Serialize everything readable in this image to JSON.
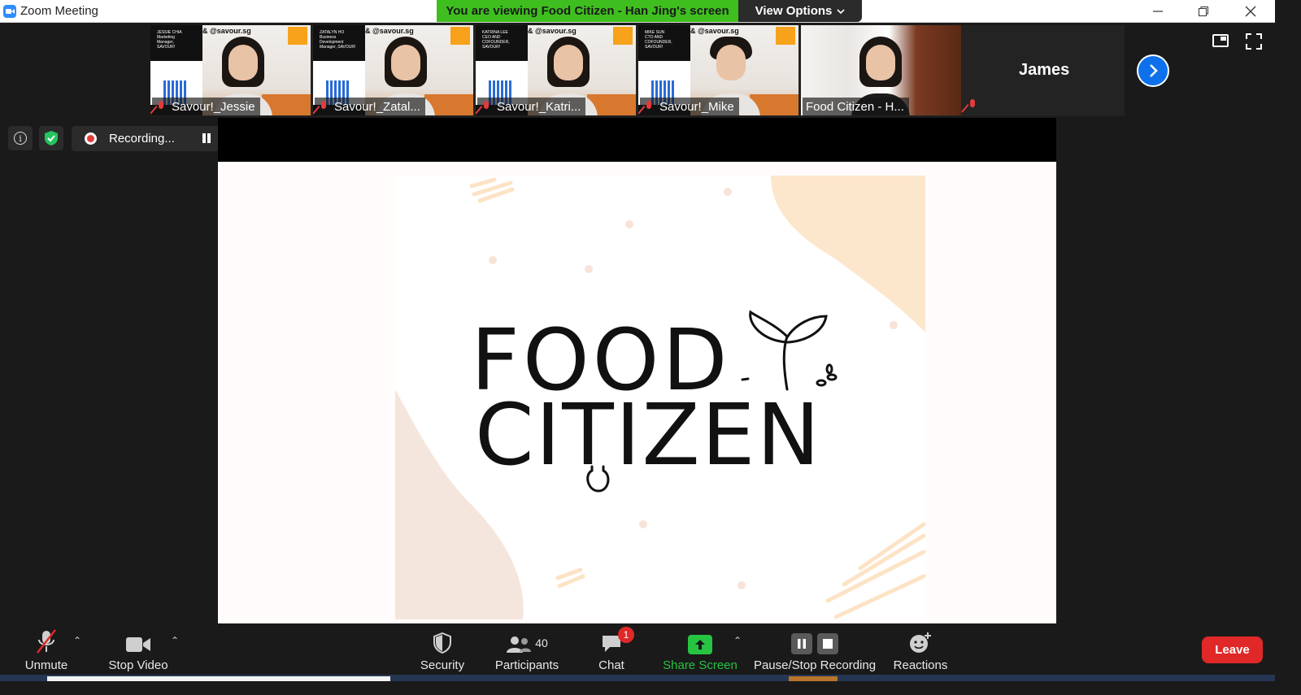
{
  "window": {
    "title": "Zoom Meeting",
    "viewing_banner": "You are viewing Food Citizen - Han Jing's screen",
    "view_options_label": "View Options"
  },
  "participants_strip": [
    {
      "name": "Savour!_Jessie",
      "card_text": "JESSIE CHIA\nMarketing\nManager,\nSAVOUR!",
      "muted": true
    },
    {
      "name": "Savour!_Zatal...",
      "card_text": "ZATALYN HO\nBusiness\nDevelopment\nManager, SAVOUR!",
      "muted": true
    },
    {
      "name": "Savour!_Katri...",
      "card_text": "KATRINA LEE\nCEO AND\nCOFOUNDER,\nSAVOUR!",
      "muted": true
    },
    {
      "name": "Savour!_Mike",
      "card_text": "MIKE SUN\nCTO AND\nCOFOUNDER,\nSAVOUR!",
      "muted": true
    },
    {
      "name": "Food Citizen - H...",
      "active": true
    }
  ],
  "instagram_tag": "& @savour.sg",
  "james_tile": {
    "name": "James",
    "muted": true
  },
  "recording": {
    "label": "Recording..."
  },
  "slide": {
    "line1": "FOOD",
    "line2": "CITIZEN"
  },
  "toolbar": {
    "unmute": "Unmute",
    "stop_video": "Stop Video",
    "security": "Security",
    "participants": "Participants",
    "participants_count": "40",
    "chat": "Chat",
    "chat_badge": "1",
    "share_screen": "Share Screen",
    "pause_stop_recording": "Pause/Stop Recording",
    "reactions": "Reactions",
    "leave": "Leave"
  },
  "colors": {
    "banner_green": "#3fbf1f",
    "active_outline": "#9ee02c",
    "share_green": "#26c441",
    "leave_red": "#e02828",
    "next_blue": "#0e71eb",
    "peach": "#fde7cc"
  }
}
